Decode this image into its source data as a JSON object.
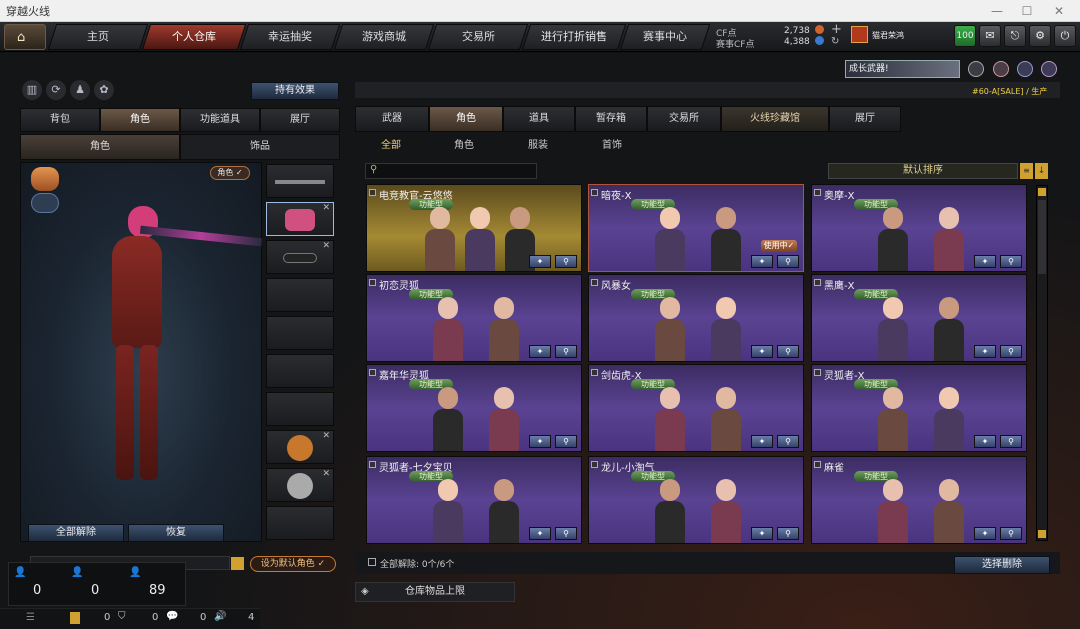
{
  "window": {
    "title": "穿越火线"
  },
  "nav": {
    "tabs": [
      "主页",
      "个人仓库",
      "幸运抽奖",
      "游戏商城",
      "交易所",
      "进行打折销售",
      "赛事中心"
    ],
    "cf_label": "CF点",
    "cf_value": "2,738",
    "match_label": "赛事CF点",
    "match_value": "4,388",
    "plus": "+",
    "user": "猫君荣鸿",
    "level": "100"
  },
  "banner": {
    "promo_text": "成长武器!",
    "sub_text": "#60-A[SALE] / 生产"
  },
  "left": {
    "effect_button": "持有效果",
    "tabs": [
      "背包",
      "角色",
      "功能道具",
      "展厅"
    ],
    "subtabs": [
      "角色",
      "饰品"
    ],
    "role_tag": "角色 ✓",
    "release_all": "全部解除",
    "restore": "恢复",
    "set_default": "设为默认角色 ✓"
  },
  "right": {
    "tabs": [
      "武器",
      "角色",
      "道具",
      "暂存箱",
      "交易所",
      "火线珍藏馆",
      "展厅"
    ],
    "filters": [
      "全部",
      "角色",
      "服装",
      "首饰"
    ],
    "sort_label": "默认排序",
    "cards": [
      {
        "title": "电竞教官-云悠悠",
        "badge": "功能型",
        "style": "gold"
      },
      {
        "title": "暗夜-X",
        "badge": "功能型",
        "inuse": "使用中✓",
        "style": "selected"
      },
      {
        "title": "奥摩-X",
        "badge": "功能型"
      },
      {
        "title": "初恋灵狐",
        "badge": "功能型"
      },
      {
        "title": "风暴女",
        "badge": "功能型"
      },
      {
        "title": "黑鹰-X",
        "badge": "功能型"
      },
      {
        "title": "嘉年华灵狐",
        "badge": "功能型"
      },
      {
        "title": "剑齿虎-X",
        "badge": "功能型"
      },
      {
        "title": "灵狐者-X",
        "badge": "功能型"
      },
      {
        "title": "灵狐者-七夕宝贝",
        "badge": "功能型"
      },
      {
        "title": "龙儿-小淘气",
        "badge": "功能型"
      },
      {
        "title": "麻雀",
        "badge": "功能型"
      }
    ],
    "release_count": "全部解除: 0个/6个",
    "select_delete": "选择删除",
    "storage_limit": "仓库物品上限"
  },
  "status": {
    "a": "0",
    "b": "0",
    "c": "89",
    "d": "0",
    "e": "0",
    "f": "0",
    "g": "4"
  },
  "colors": {
    "accent": "#a1392c",
    "card_purple": "#5a4392",
    "gold": "#a58a34"
  }
}
